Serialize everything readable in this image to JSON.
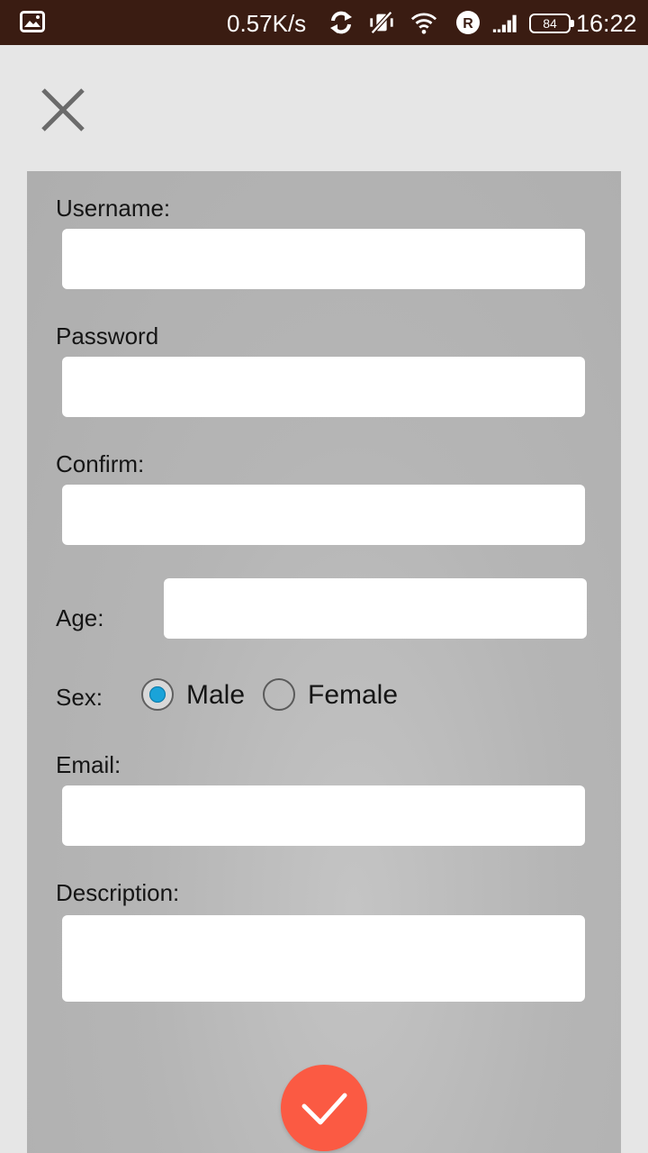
{
  "status_bar": {
    "net_speed": "0.57K/s",
    "battery": "84",
    "time": "16:22"
  },
  "form": {
    "username_label": "Username:",
    "username_value": "",
    "password_label": "Password",
    "password_value": "",
    "confirm_label": "Confirm:",
    "confirm_value": "",
    "age_label": "Age:",
    "age_value": "",
    "sex_label": "Sex:",
    "sex_options": [
      "Male",
      "Female"
    ],
    "sex_selected": "Male",
    "email_label": "Email:",
    "email_value": "",
    "description_label": "Description:",
    "description_value": ""
  },
  "colors": {
    "status_bar_bg": "#3a1c12",
    "page_bg": "#e6e6e6",
    "panel_bg": "#b5b5b5",
    "accent_radio": "#1aa3d9",
    "submit_button": "#fb5a43"
  },
  "icons": {
    "close": "close-icon",
    "submit": "checkmark-icon"
  }
}
